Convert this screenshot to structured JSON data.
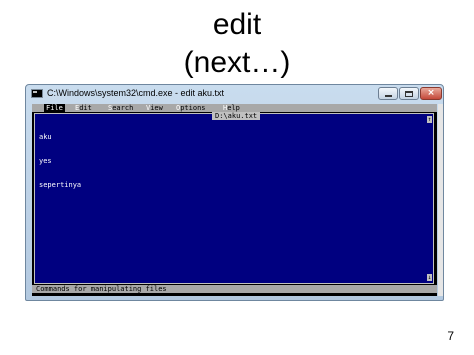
{
  "slide": {
    "title_line1": "edit",
    "title_line2": "(next…)",
    "page_number": "7"
  },
  "window": {
    "title": "C:\\Windows\\system32\\cmd.exe - edit  aku.txt",
    "icon": "cmd-icon",
    "buttons": {
      "minimize": "minimize-icon",
      "maximize": "maximize-icon",
      "close": "×"
    }
  },
  "editor": {
    "menu": [
      {
        "hot": "F",
        "rest": "ile"
      },
      {
        "hot": "E",
        "rest": "dit"
      },
      {
        "hot": "S",
        "rest": "earch"
      },
      {
        "hot": "V",
        "rest": "iew"
      },
      {
        "hot": "O",
        "rest": "ptions"
      },
      {
        "hot": "H",
        "rest": "elp"
      }
    ],
    "document_title": "D:\\aku.txt",
    "lines": [
      "aku",
      "yes",
      "sepertinya"
    ],
    "status": "Commands for manipulating files",
    "colors": {
      "background": "#000080",
      "text": "#ffffff",
      "menubar": "#a8a8a8"
    }
  }
}
